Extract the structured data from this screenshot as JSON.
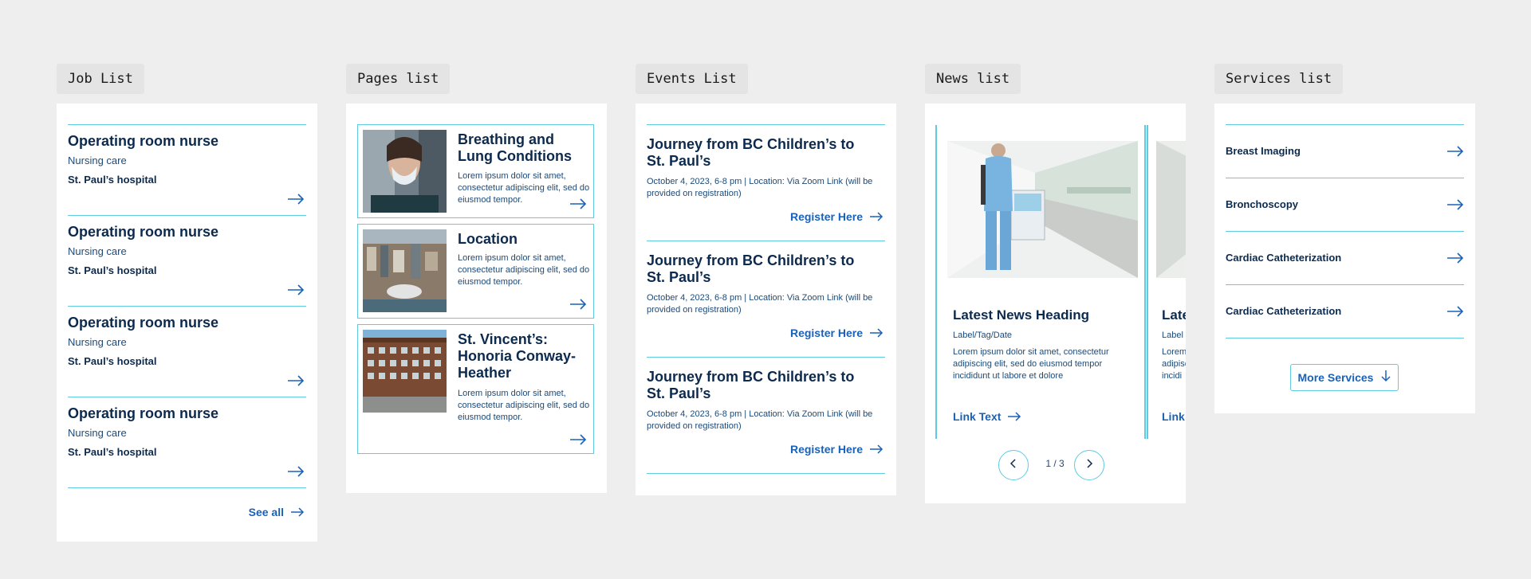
{
  "sections": {
    "jobs": "Job List",
    "pages": "Pages list",
    "events": "Events List",
    "news": "News list",
    "services": "Services list"
  },
  "jobs": {
    "items": [
      {
        "title": "Operating room nurse",
        "category": "Nursing care",
        "location": "St. Paul’s hospital"
      },
      {
        "title": "Operating room nurse",
        "category": "Nursing care",
        "location": "St. Paul’s hospital"
      },
      {
        "title": "Operating room nurse",
        "category": "Nursing care",
        "location": "St. Paul’s hospital"
      },
      {
        "title": "Operating room nurse",
        "category": "Nursing care",
        "location": "St. Paul’s hospital"
      }
    ],
    "see_all": "See all"
  },
  "pages": {
    "items": [
      {
        "title": "Breathing and Lung Conditions",
        "desc": "Lorem ipsum dolor sit amet, consectetur adipiscing elit, sed do eiusmod tempor."
      },
      {
        "title": "Location",
        "desc": "Lorem ipsum dolor sit amet, consectetur adipiscing elit, sed do eiusmod tempor."
      },
      {
        "title": "St. Vincent’s: Honoria Conway-Heather",
        "desc": "Lorem ipsum dolor sit amet, consectetur adipiscing elit, sed do eiusmod tempor."
      }
    ]
  },
  "events": {
    "items": [
      {
        "title": "Journey from BC Children’s to St. Paul’s",
        "details": "October 4, 2023, 6-8 pm   |   Location: Via Zoom Link (will be provided on registration)",
        "cta": "Register Here"
      },
      {
        "title": "Journey from BC Children’s to St. Paul’s",
        "details": "October 4, 2023, 6-8 pm   |   Location: Via Zoom Link (will be provided on registration)",
        "cta": "Register Here"
      },
      {
        "title": "Journey from BC Children’s to St. Paul’s",
        "details": "October 4, 2023, 6-8 pm   |   Location: Via Zoom Link (will be provided on registration)",
        "cta": "Register Here"
      }
    ]
  },
  "news": {
    "heading": "Latest News Heading",
    "label": "Label/Tag/Date",
    "desc": "Lorem ipsum dolor sit amet, consectetur adipiscing elit, sed do eiusmod tempor incididunt ut labore et dolore",
    "link": "Link Text",
    "peek_heading": "Late",
    "peek_label": "Label",
    "peek_desc": "Lorem adipisc incidi",
    "peek_link": "Link T",
    "pager": "1 / 3"
  },
  "services": {
    "items": [
      "Breast Imaging",
      "Bronchoscopy",
      "Cardiac Catheterization",
      "Cardiac Catheterization"
    ],
    "more": "More Services"
  },
  "colors": {
    "accent": "#5fcbe0",
    "link": "#1a62b8",
    "heading": "#0c2a4e",
    "background": "#eeeeee"
  },
  "icons": [
    "arrow-right-icon",
    "arrow-down-icon",
    "chevron-left-icon",
    "chevron-right-icon"
  ]
}
